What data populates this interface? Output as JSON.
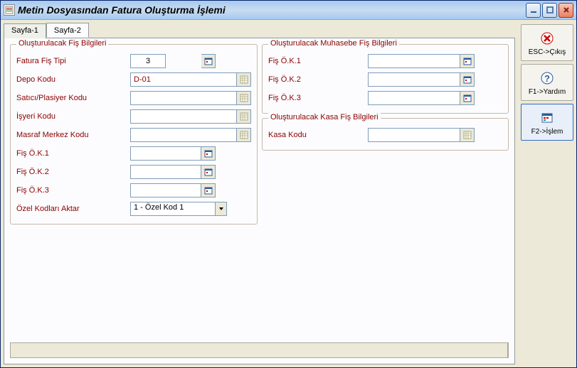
{
  "window": {
    "title": "Metin Dosyasından Fatura Oluşturma İşlemi"
  },
  "tabs": {
    "t1": "Sayfa-1",
    "t2": "Sayfa-2"
  },
  "group1": {
    "title": "Oluşturulacak Fiş Bilgileri",
    "r1_label": "Fatura Fiş Tipi",
    "r1_value": "3",
    "r2_label": "Depo Kodu",
    "r2_value": "D-01",
    "r3_label": "Satıcı/Plasiyer Kodu",
    "r3_value": "",
    "r4_label": "İşyeri Kodu",
    "r4_value": "",
    "r5_label": "Masraf Merkez Kodu",
    "r5_value": "",
    "r6_label": "Fiş Ö.K.1",
    "r6_value": "",
    "r7_label": "Fiş Ö.K.2",
    "r7_value": "",
    "r8_label": "Fiş Ö.K.3",
    "r8_value": "",
    "r9_label": "Özel Kodları Aktar",
    "r9_value": "1 - Özel Kod 1"
  },
  "group2": {
    "title": "Oluşturulacak Muhasebe Fiş Bilgileri",
    "r1_label": "Fiş Ö.K.1",
    "r1_value": "",
    "r2_label": "Fiş Ö.K.2",
    "r2_value": "",
    "r3_label": "Fiş Ö.K.3",
    "r3_value": ""
  },
  "group3": {
    "title": "Oluşturulacak Kasa Fiş Bilgileri",
    "r1_label": "Kasa Kodu",
    "r1_value": ""
  },
  "sidebar": {
    "b1": "ESC->Çıkış",
    "b2": "F1->Yardım",
    "b3": "F2->İşlem"
  },
  "status": ""
}
